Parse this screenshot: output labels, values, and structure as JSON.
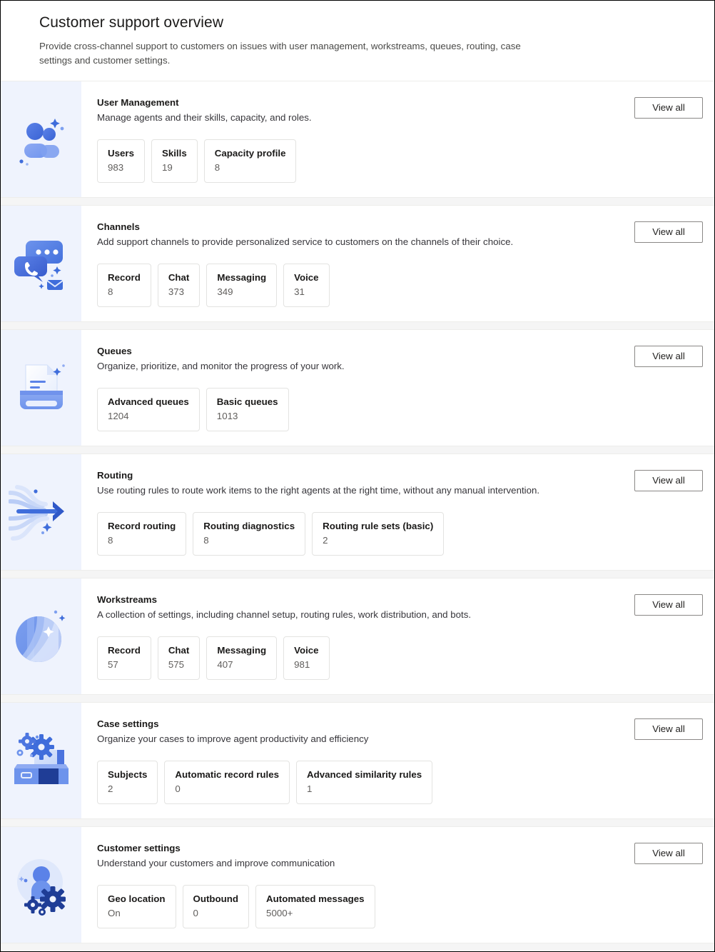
{
  "header": {
    "title": "Customer support overview",
    "subtitle": "Provide cross-channel support to customers on issues with user management, workstreams, queues, routing, case settings and customer settings."
  },
  "common": {
    "view_all_label": "View all"
  },
  "colors": {
    "art_panel_bg": "#eff3fd",
    "accent_blue": "#3f6ddb",
    "accent_blue_light": "#7c9df0",
    "card_bg": "#ffffff",
    "page_bg": "#f5f5f5",
    "title_text": "#1b1a19",
    "value_text": "#605e5c"
  },
  "cards": [
    {
      "icon": "people-group-icon",
      "title": "User Management",
      "description": "Manage agents and their skills, capacity, and roles.",
      "action_label": "View all",
      "stats": [
        {
          "label": "Users",
          "value": "983"
        },
        {
          "label": "Skills",
          "value": "19"
        },
        {
          "label": "Capacity profile",
          "value": "8"
        }
      ]
    },
    {
      "icon": "chat-phone-mail-icon",
      "title": "Channels",
      "description": "Add support channels to provide personalized service to customers on the channels of their choice.",
      "action_label": "View all",
      "stats": [
        {
          "label": "Record",
          "value": "8"
        },
        {
          "label": "Chat",
          "value": "373"
        },
        {
          "label": "Messaging",
          "value": "349"
        },
        {
          "label": "Voice",
          "value": "31"
        }
      ]
    },
    {
      "icon": "document-tray-icon",
      "title": "Queues",
      "description": "Organize, prioritize, and monitor the progress of your work.",
      "action_label": "View all",
      "stats": [
        {
          "label": "Advanced queues",
          "value": "1204"
        },
        {
          "label": "Basic queues",
          "value": "1013"
        }
      ]
    },
    {
      "icon": "arrow-flow-icon",
      "title": "Routing",
      "description": "Use routing rules to route work items to the right agents at the right time, without any manual intervention.",
      "action_label": "View all",
      "stats": [
        {
          "label": "Record routing",
          "value": "8"
        },
        {
          "label": "Routing diagnostics",
          "value": "8"
        },
        {
          "label": "Routing rule sets (basic)",
          "value": "2"
        }
      ]
    },
    {
      "icon": "sphere-streams-icon",
      "title": "Workstreams",
      "description": "A collection of settings, including channel setup, routing rules, work distribution, and bots.",
      "action_label": "View all",
      "stats": [
        {
          "label": "Record",
          "value": "57"
        },
        {
          "label": "Chat",
          "value": "575"
        },
        {
          "label": "Messaging",
          "value": "407"
        },
        {
          "label": "Voice",
          "value": "981"
        }
      ]
    },
    {
      "icon": "toolbox-gears-icon",
      "title": "Case settings",
      "description": "Organize your cases to improve agent productivity and efficiency",
      "action_label": "View all",
      "stats": [
        {
          "label": "Subjects",
          "value": "2"
        },
        {
          "label": "Automatic record rules",
          "value": "0"
        },
        {
          "label": "Advanced similarity rules",
          "value": "1"
        }
      ]
    },
    {
      "icon": "person-gears-icon",
      "title": "Customer settings",
      "description": "Understand your customers and improve communication",
      "action_label": "View all",
      "stats": [
        {
          "label": "Geo location",
          "value": "On"
        },
        {
          "label": "Outbound",
          "value": "0"
        },
        {
          "label": "Automated messages",
          "value": "5000+"
        }
      ]
    }
  ]
}
